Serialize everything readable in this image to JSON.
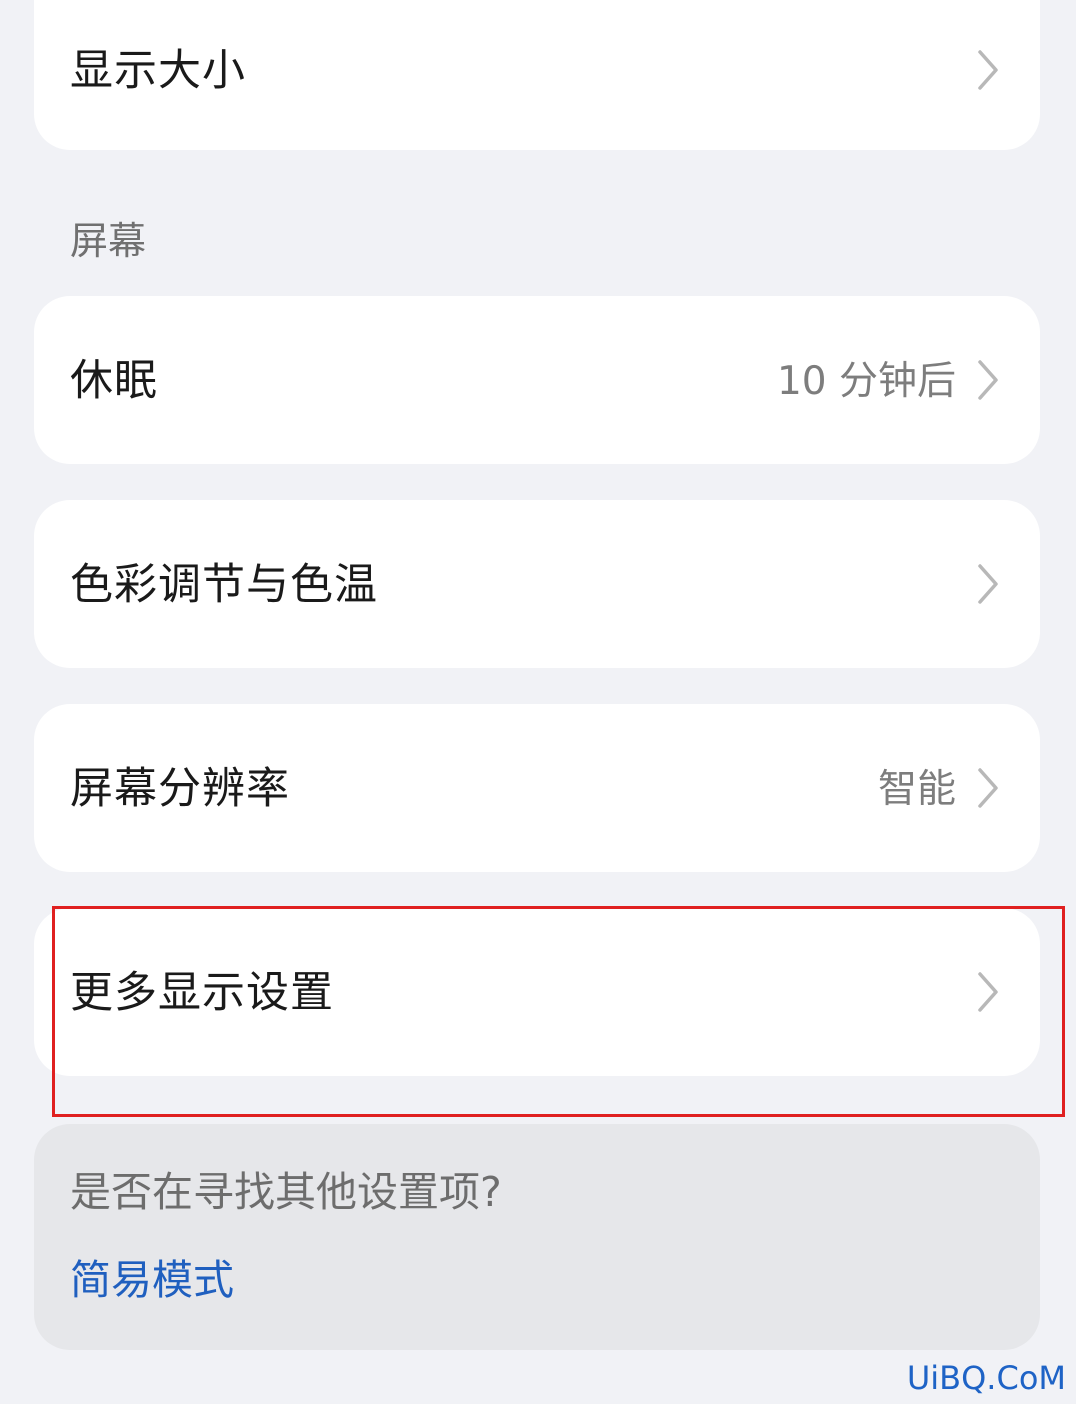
{
  "rows": {
    "display_size": {
      "label": "显示大小"
    },
    "sleep": {
      "label": "休眠",
      "value": "10 分钟后"
    },
    "color": {
      "label": "色彩调节与色温"
    },
    "resolution": {
      "label": "屏幕分辨率",
      "value": "智能"
    },
    "more": {
      "label": "更多显示设置"
    }
  },
  "section": {
    "screen_title": "屏幕"
  },
  "hint": {
    "question": "是否在寻找其他设置项?",
    "link": "简易模式"
  },
  "watermark": "UiBQ.CoM",
  "icons": {
    "chevron": "chevron-right-icon"
  },
  "colors": {
    "background": "#f1f2f6",
    "card": "#ffffff",
    "link": "#1f5fbf",
    "highlight": "#e02020",
    "watermark": "#1e63c6"
  }
}
